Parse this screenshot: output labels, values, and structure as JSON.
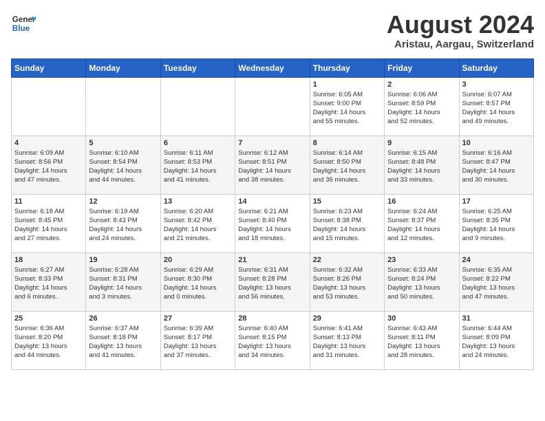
{
  "header": {
    "logo_line1": "General",
    "logo_line2": "Blue",
    "month_title": "August 2024",
    "location": "Aristau, Aargau, Switzerland"
  },
  "weekdays": [
    "Sunday",
    "Monday",
    "Tuesday",
    "Wednesday",
    "Thursday",
    "Friday",
    "Saturday"
  ],
  "weeks": [
    [
      {
        "day": "",
        "info": ""
      },
      {
        "day": "",
        "info": ""
      },
      {
        "day": "",
        "info": ""
      },
      {
        "day": "",
        "info": ""
      },
      {
        "day": "1",
        "info": "Sunrise: 6:05 AM\nSunset: 9:00 PM\nDaylight: 14 hours\nand 55 minutes."
      },
      {
        "day": "2",
        "info": "Sunrise: 6:06 AM\nSunset: 8:59 PM\nDaylight: 14 hours\nand 52 minutes."
      },
      {
        "day": "3",
        "info": "Sunrise: 6:07 AM\nSunset: 8:57 PM\nDaylight: 14 hours\nand 49 minutes."
      }
    ],
    [
      {
        "day": "4",
        "info": "Sunrise: 6:09 AM\nSunset: 8:56 PM\nDaylight: 14 hours\nand 47 minutes."
      },
      {
        "day": "5",
        "info": "Sunrise: 6:10 AM\nSunset: 8:54 PM\nDaylight: 14 hours\nand 44 minutes."
      },
      {
        "day": "6",
        "info": "Sunrise: 6:11 AM\nSunset: 8:53 PM\nDaylight: 14 hours\nand 41 minutes."
      },
      {
        "day": "7",
        "info": "Sunrise: 6:12 AM\nSunset: 8:51 PM\nDaylight: 14 hours\nand 38 minutes."
      },
      {
        "day": "8",
        "info": "Sunrise: 6:14 AM\nSunset: 8:50 PM\nDaylight: 14 hours\nand 36 minutes."
      },
      {
        "day": "9",
        "info": "Sunrise: 6:15 AM\nSunset: 8:48 PM\nDaylight: 14 hours\nand 33 minutes."
      },
      {
        "day": "10",
        "info": "Sunrise: 6:16 AM\nSunset: 8:47 PM\nDaylight: 14 hours\nand 30 minutes."
      }
    ],
    [
      {
        "day": "11",
        "info": "Sunrise: 6:18 AM\nSunset: 8:45 PM\nDaylight: 14 hours\nand 27 minutes."
      },
      {
        "day": "12",
        "info": "Sunrise: 6:19 AM\nSunset: 8:43 PM\nDaylight: 14 hours\nand 24 minutes."
      },
      {
        "day": "13",
        "info": "Sunrise: 6:20 AM\nSunset: 8:42 PM\nDaylight: 14 hours\nand 21 minutes."
      },
      {
        "day": "14",
        "info": "Sunrise: 6:21 AM\nSunset: 8:40 PM\nDaylight: 14 hours\nand 18 minutes."
      },
      {
        "day": "15",
        "info": "Sunrise: 6:23 AM\nSunset: 8:38 PM\nDaylight: 14 hours\nand 15 minutes."
      },
      {
        "day": "16",
        "info": "Sunrise: 6:24 AM\nSunset: 8:37 PM\nDaylight: 14 hours\nand 12 minutes."
      },
      {
        "day": "17",
        "info": "Sunrise: 6:25 AM\nSunset: 8:35 PM\nDaylight: 14 hours\nand 9 minutes."
      }
    ],
    [
      {
        "day": "18",
        "info": "Sunrise: 6:27 AM\nSunset: 8:33 PM\nDaylight: 14 hours\nand 6 minutes."
      },
      {
        "day": "19",
        "info": "Sunrise: 6:28 AM\nSunset: 8:31 PM\nDaylight: 14 hours\nand 3 minutes."
      },
      {
        "day": "20",
        "info": "Sunrise: 6:29 AM\nSunset: 8:30 PM\nDaylight: 14 hours\nand 0 minutes."
      },
      {
        "day": "21",
        "info": "Sunrise: 6:31 AM\nSunset: 8:28 PM\nDaylight: 13 hours\nand 56 minutes."
      },
      {
        "day": "22",
        "info": "Sunrise: 6:32 AM\nSunset: 8:26 PM\nDaylight: 13 hours\nand 53 minutes."
      },
      {
        "day": "23",
        "info": "Sunrise: 6:33 AM\nSunset: 8:24 PM\nDaylight: 13 hours\nand 50 minutes."
      },
      {
        "day": "24",
        "info": "Sunrise: 6:35 AM\nSunset: 8:22 PM\nDaylight: 13 hours\nand 47 minutes."
      }
    ],
    [
      {
        "day": "25",
        "info": "Sunrise: 6:36 AM\nSunset: 8:20 PM\nDaylight: 13 hours\nand 44 minutes."
      },
      {
        "day": "26",
        "info": "Sunrise: 6:37 AM\nSunset: 8:18 PM\nDaylight: 13 hours\nand 41 minutes."
      },
      {
        "day": "27",
        "info": "Sunrise: 6:39 AM\nSunset: 8:17 PM\nDaylight: 13 hours\nand 37 minutes."
      },
      {
        "day": "28",
        "info": "Sunrise: 6:40 AM\nSunset: 8:15 PM\nDaylight: 13 hours\nand 34 minutes."
      },
      {
        "day": "29",
        "info": "Sunrise: 6:41 AM\nSunset: 8:13 PM\nDaylight: 13 hours\nand 31 minutes."
      },
      {
        "day": "30",
        "info": "Sunrise: 6:43 AM\nSunset: 8:11 PM\nDaylight: 13 hours\nand 28 minutes."
      },
      {
        "day": "31",
        "info": "Sunrise: 6:44 AM\nSunset: 8:09 PM\nDaylight: 13 hours\nand 24 minutes."
      }
    ]
  ]
}
